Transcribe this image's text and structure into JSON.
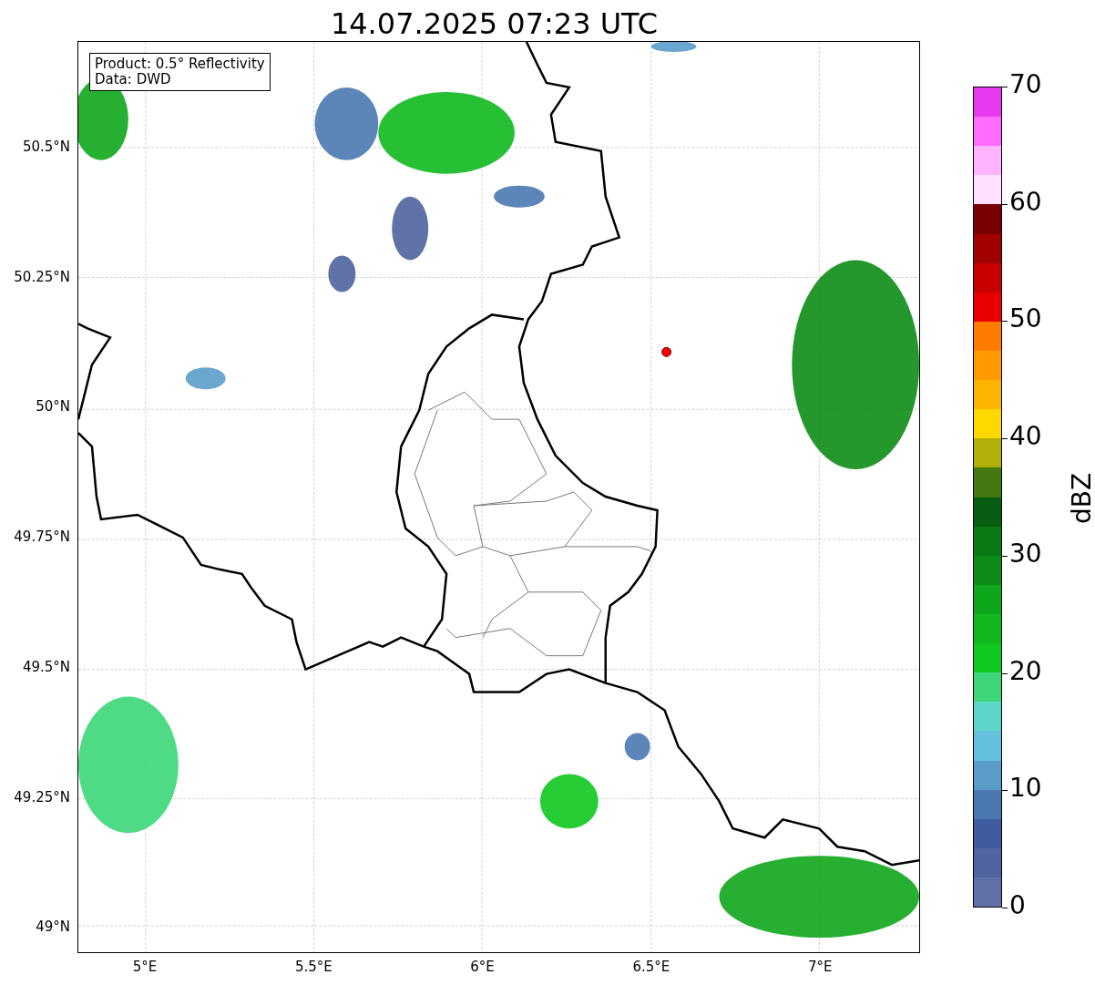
{
  "title": "14.07.2025 07:23 UTC",
  "map": {
    "info_box": [
      "Product: 0.5° Reflectivity",
      "Data: DWD"
    ],
    "x_ticks": [
      "5°E",
      "5.5°E",
      "6°E",
      "6.5°E",
      "7°E"
    ],
    "y_ticks": [
      "50.5°N",
      "50.25°N",
      "50°N",
      "49.75°N",
      "49.5°N",
      "49.25°N",
      "49°N"
    ]
  },
  "colorbar": {
    "label": "dBZ",
    "ticks": [
      "70",
      "60",
      "50",
      "40",
      "30",
      "20",
      "10",
      "0"
    ],
    "segments": [
      {
        "color": "#e838f0"
      },
      {
        "color": "#ff6cff"
      },
      {
        "color": "#ffb4ff"
      },
      {
        "color": "#ffe0ff"
      },
      {
        "color": "#780000"
      },
      {
        "color": "#a00000"
      },
      {
        "color": "#c80000"
      },
      {
        "color": "#e80000"
      },
      {
        "color": "#ff7c00"
      },
      {
        "color": "#ff9a00"
      },
      {
        "color": "#ffb400"
      },
      {
        "color": "#ffd800"
      },
      {
        "color": "#b0b00a"
      },
      {
        "color": "#447810"
      },
      {
        "color": "#085e10"
      },
      {
        "color": "#0a7814"
      },
      {
        "color": "#0c8c16"
      },
      {
        "color": "#0ea61a"
      },
      {
        "color": "#10b81e"
      },
      {
        "color": "#10c81e"
      },
      {
        "color": "#3cd678"
      },
      {
        "color": "#5cd6c8"
      },
      {
        "color": "#64c0dc"
      },
      {
        "color": "#5a9cc8"
      },
      {
        "color": "#4a78b0"
      },
      {
        "color": "#405ca0"
      },
      {
        "color": "#4f64a0"
      },
      {
        "color": "#6272a8"
      }
    ]
  }
}
